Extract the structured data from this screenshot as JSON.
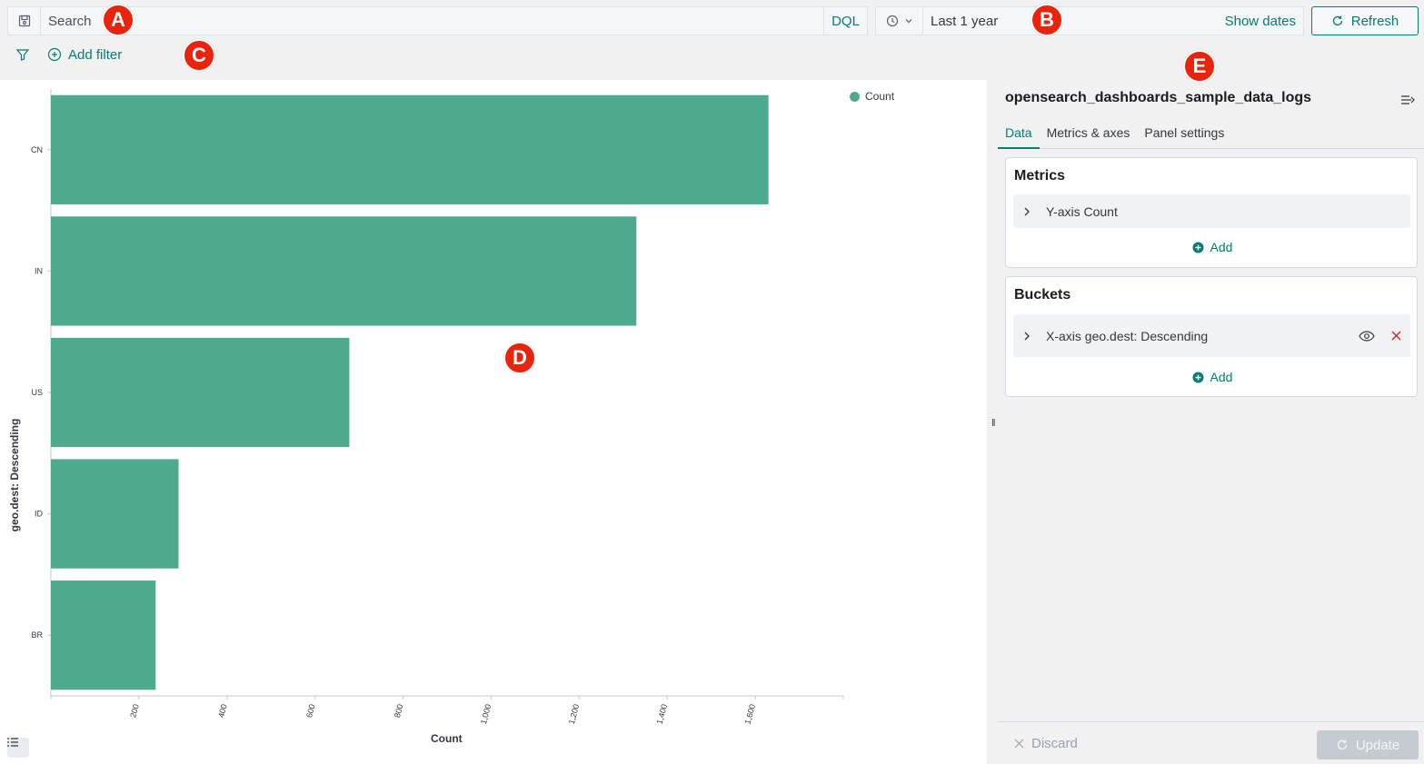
{
  "query": {
    "search_placeholder": "Search",
    "language": "DQL"
  },
  "time": {
    "range": "Last 1 year",
    "show_dates": "Show dates",
    "refresh": "Refresh"
  },
  "filter": {
    "add_filter": "Add filter"
  },
  "chart_data": {
    "type": "bar",
    "orientation": "horizontal",
    "categories": [
      "CN",
      "IN",
      "US",
      "ID",
      "BR"
    ],
    "values": [
      1630,
      1330,
      678,
      290,
      238
    ],
    "series": [
      {
        "name": "Count",
        "values": [
          1630,
          1330,
          678,
          290,
          238
        ]
      }
    ],
    "xlabel": "Count",
    "ylabel": "geo.dest: Descending",
    "xlim": [
      0,
      1800
    ],
    "x_ticks": [
      "200",
      "400",
      "600",
      "800",
      "1,000",
      "1,200",
      "1,400",
      "1,600"
    ],
    "x_tick_values": [
      200,
      400,
      600,
      800,
      1000,
      1200,
      1400,
      1600
    ],
    "legend_placement": "top-right",
    "grid": false,
    "color": "#4daa8d"
  },
  "panel": {
    "title": "opensearch_dashboards_sample_data_logs",
    "tabs": [
      "Data",
      "Metrics & axes",
      "Panel settings"
    ],
    "metrics": {
      "heading": "Metrics",
      "items": [
        {
          "label": "Y-axis Count"
        }
      ],
      "add": "Add"
    },
    "buckets": {
      "heading": "Buckets",
      "items": [
        {
          "label": "X-axis geo.dest: Descending"
        }
      ],
      "add": "Add"
    },
    "discard": "Discard",
    "update": "Update"
  },
  "markers": [
    "A",
    "B",
    "C",
    "D",
    "E"
  ],
  "colors": {
    "accent": "#017d73",
    "bar": "#4daa8d",
    "marker": "#e8240d",
    "remove": "#bd271e"
  }
}
